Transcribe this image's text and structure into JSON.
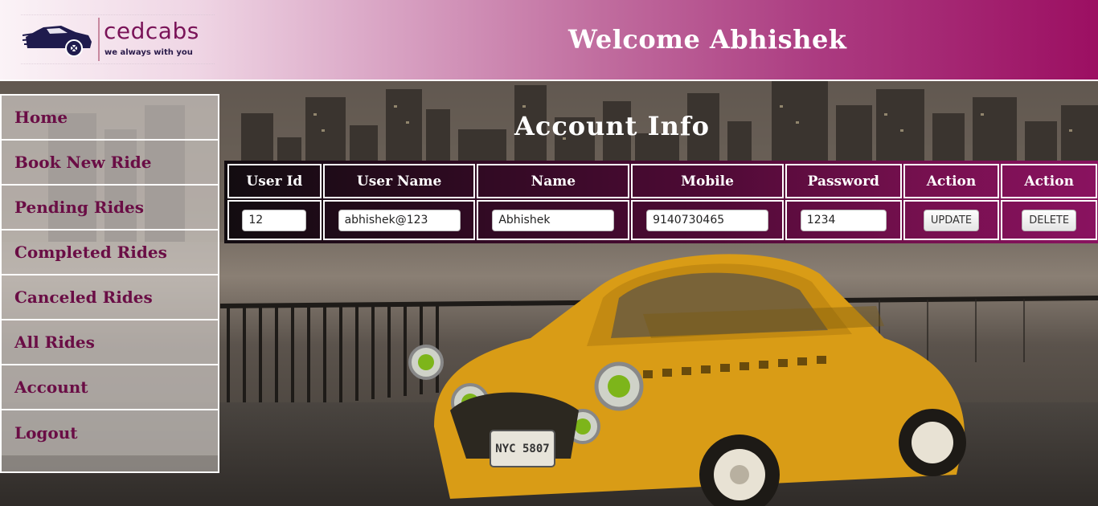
{
  "header": {
    "logo_name": "cedcabs",
    "logo_tagline": "we always with you",
    "welcome": "Welcome Abhishek"
  },
  "sidebar": {
    "items": [
      {
        "label": "Home"
      },
      {
        "label": "Book New Ride"
      },
      {
        "label": "Pending Rides"
      },
      {
        "label": "Completed Rides"
      },
      {
        "label": "Canceled Rides"
      },
      {
        "label": "All Rides"
      },
      {
        "label": "Account"
      },
      {
        "label": "Logout"
      }
    ]
  },
  "account": {
    "title": "Account Info",
    "columns": [
      "User Id",
      "User Name",
      "Name",
      "Mobile",
      "Password",
      "Action",
      "Action"
    ],
    "row": {
      "user_id": "12",
      "user_name": "abhishek@123",
      "name": "Abhishek",
      "mobile": "9140730465",
      "password": "1234",
      "update_label": "UPDATE",
      "delete_label": "DELETE"
    }
  },
  "colors": {
    "brand": "#9c0f62",
    "nav_text": "#6a0d45",
    "taxi_yellow": "#e0a91a"
  },
  "icons": {
    "logo": "car-logo-icon"
  }
}
